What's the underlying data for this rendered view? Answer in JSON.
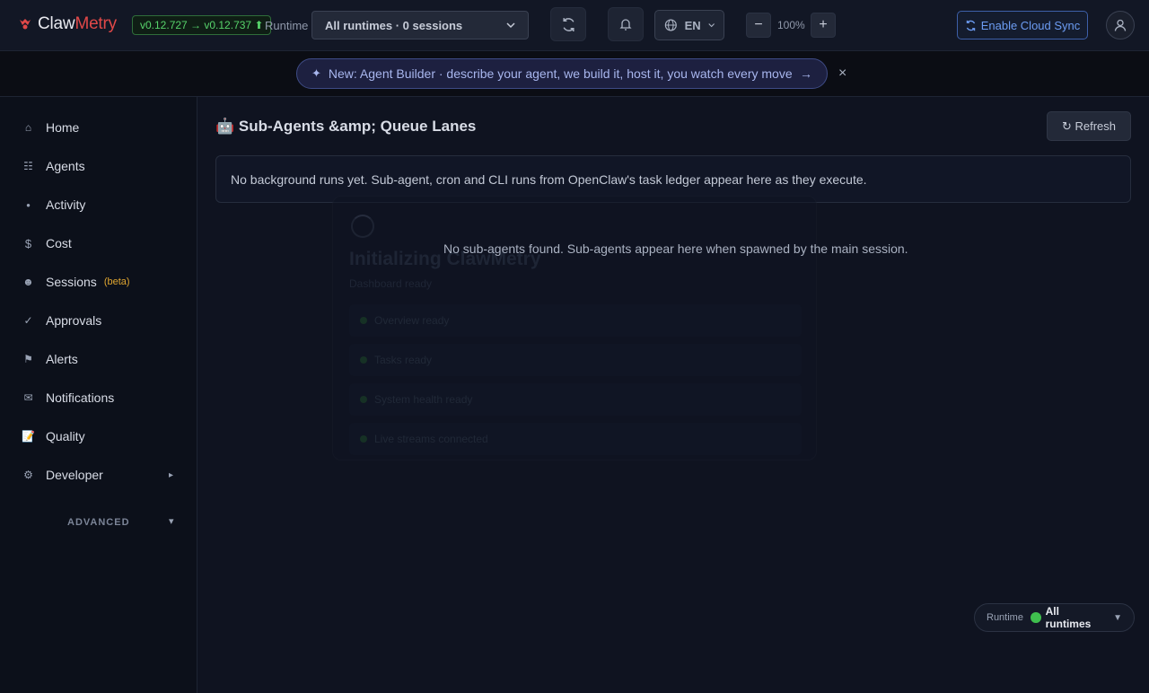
{
  "header": {
    "logo_claw": "Claw",
    "logo_metry": "Metry",
    "version": "v0.12.727 → v0.12.737 ⬆",
    "runtime_label": "Runtime",
    "runtime_select": "All runtimes · 0 sessions",
    "language": "EN",
    "zoom_out": "−",
    "zoom_level": "100%",
    "zoom_in": "+",
    "cloud_sync": "Enable Cloud Sync"
  },
  "announcement": {
    "text": "New: Agent Builder · describe your agent, we build it, host it, you watch every move",
    "arrow": "→",
    "close": "×"
  },
  "sidebar": {
    "items": [
      {
        "label": "Home",
        "icon": "⌂"
      },
      {
        "label": "Agents",
        "icon": "☷"
      },
      {
        "label": "Activity",
        "icon": "●"
      },
      {
        "label": "Cost",
        "icon": "$"
      },
      {
        "label": "Sessions",
        "icon": "☻",
        "badge": "(beta)"
      },
      {
        "label": "Approvals",
        "icon": "✓"
      },
      {
        "label": "Alerts",
        "icon": "⚑"
      },
      {
        "label": "Notifications",
        "icon": "✉"
      },
      {
        "label": "Quality",
        "icon": "📝"
      },
      {
        "label": "Developer",
        "icon": "⚙",
        "caret": "▸"
      }
    ],
    "advanced_label": "ADVANCED",
    "advanced_caret": "▾"
  },
  "main": {
    "title": "🤖 Sub-Agents &amp; Queue Lanes",
    "refresh": "↻ Refresh",
    "notice": "No background runs yet. Sub-agent, cron and CLI runs from OpenClaw's task ledger appear here as they execute.",
    "empty": "No sub-agents found. Sub-agents appear here when spawned by the main session."
  },
  "loader": {
    "title": "Initializing ClawMetry",
    "subtitle": "Dashboard ready",
    "steps": [
      "Overview ready",
      "Tasks ready",
      "System health ready",
      "Live streams connected"
    ]
  },
  "runtime_pill": {
    "label": "Runtime",
    "value": "All runtimes",
    "caret": "▼"
  }
}
